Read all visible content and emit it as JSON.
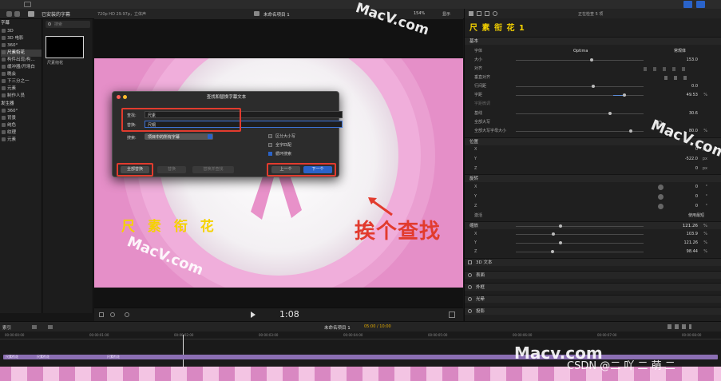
{
  "library": {
    "title": "已安装的字幕",
    "section_top": "字幕",
    "items": [
      "3D",
      "3D 电影",
      "360°",
      "尺素衔花",
      "构件出现/构…",
      "缓冲器/开场白",
      "晚会",
      "下三分之一",
      "元素",
      "制作人员"
    ],
    "section_gen": "发生器",
    "gen_items": [
      "360°",
      "背景",
      "纯色",
      "纹理",
      "元素"
    ],
    "search_placeholder": "搜索",
    "thumbnail_label": "尺素衔花"
  },
  "viewer": {
    "format": "720p HD 29.97p，立体声",
    "project_name": "未命名项目 1",
    "zoom": "154%",
    "view_menu": "显示",
    "timecode": "1:08",
    "overlay_title": "尺 素 衔 花",
    "annotation": "挨个查找"
  },
  "dialog": {
    "title": "查找和替换字幕文本",
    "find_label": "查找:",
    "find_value": "尺素",
    "replace_label": "替换:",
    "replace_value": "尺铜",
    "search_label": "搜索:",
    "search_scope": "项目中的所有字幕",
    "opt_case": "区分大小写",
    "opt_whole": "全字匹配",
    "opt_loop": "循环搜索",
    "btn_replace_all": "全部替换",
    "btn_replace": "替换",
    "btn_replace_find": "替换并查找",
    "btn_prev": "上一个",
    "btn_next": "下一个"
  },
  "inspector": {
    "status": "正在检查 5 项",
    "title": "尺 素 衔 花 1",
    "sec_basic": "基本",
    "font_label": "字体",
    "font_name": "Optima",
    "font_style": "常规体",
    "size_label": "大小",
    "size_value": "153.0",
    "align_label": "对齐",
    "valign_label": "垂直对齐",
    "line_label": "行间距",
    "line_value": "0.0",
    "tracking_label": "字距",
    "tracking_value": "49.53",
    "tracking_unit": "%",
    "kern_label": "字距微调",
    "baseline_label": "基线",
    "baseline_value": "30.6",
    "allcaps_label": "全部大写",
    "allcaps_size_label": "全部大写字母大小",
    "allcaps_size_value": "80.0",
    "allcaps_size_unit": "%",
    "sec_position": "位置",
    "pos_x": "X",
    "pos_x_value": "0",
    "pos_y": "Y",
    "pos_y_value": "-522.0",
    "pos_z": "Z",
    "pos_z_value": "0",
    "px": "px",
    "sec_rotation": "旋转",
    "rot_x": "X",
    "rot_x_value": "0",
    "rot_y": "Y",
    "rot_y_value": "0",
    "rot_z": "Z",
    "rot_z_value": "0",
    "deg": "°",
    "anim_label": "激活",
    "anim_value": "使用最短",
    "sec_scale": "缩放",
    "scale_all_value": "121.26",
    "scale_x": "X",
    "scale_x_value": "103.9",
    "scale_y": "Y",
    "scale_y_value": "121.26",
    "scale_z": "Z",
    "scale_z_value": "98.44",
    "pct": "%",
    "sec_3d": "3D 文本",
    "sec_face": "表面",
    "sec_outline": "外框",
    "sec_glow": "光晕",
    "sec_shadow": "投影"
  },
  "timeline": {
    "index_label": "索引",
    "project_name": "未命名项目 1",
    "time": "05:00 / 10:00",
    "clip_label": "尺素衔花",
    "ruler": [
      "00:00:00:00",
      "00:00:01:00",
      "00:00:02:00",
      "00:00:03:00",
      "00:00:04:00",
      "00:00:05:00",
      "00:00:06:00",
      "00:00:07:00",
      "00:00:08:00"
    ]
  },
  "watermarks": {
    "wm1": "MacV.com",
    "wm2": "MacV.com",
    "wm3": "MacV.com",
    "wm4": "Macv.com",
    "csdn": "CSDN @二 吖 二 萌 二"
  },
  "colors": {
    "accent_yellow": "#f5d200",
    "annotation_red": "#e23b2e",
    "canvas_pink": "#e58fc8"
  }
}
